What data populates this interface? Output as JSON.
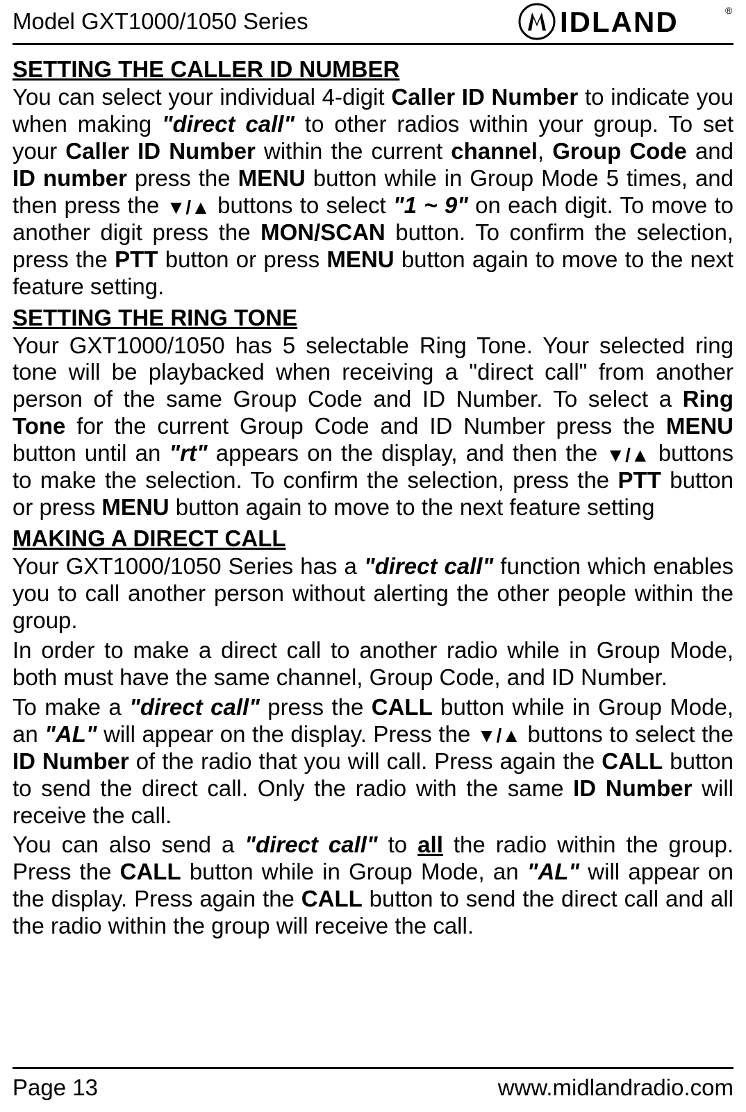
{
  "header": {
    "model": "Model GXT1000/1050 Series",
    "brand": "MIDLAND",
    "reg": "®"
  },
  "sections": {
    "s1": {
      "title": "SETTING THE CALLER ID NUMBER",
      "p1_a": "You can select your individual 4-digit ",
      "p1_b": "Caller ID Number",
      "p1_c": " to indicate you when making ",
      "p1_d": "\"direct call\"",
      "p1_e": " to other radios within your group. To set your ",
      "p1_f": "Caller ID Number",
      "p1_g": " within the current ",
      "p1_h": "channel",
      "p1_i": ", ",
      "p1_j": "Group Code",
      "p1_k": " and ",
      "p1_l": "ID number",
      "p1_m": " press the ",
      "p1_n": "MENU",
      "p1_o": " button while in Group Mode 5 times, and then press the ",
      "p1_p": " buttons to select ",
      "p1_q": "\"1 ~ 9\"",
      "p1_r": " on each digit. To move to another digit press the ",
      "p1_s": "MON/SCAN",
      "p1_t": " button. To confirm the selection, press the ",
      "p1_u": "PTT",
      "p1_v": " button or press ",
      "p1_w": "MENU",
      "p1_x": " button again to move to the next feature setting."
    },
    "s2": {
      "title": "SETTING THE RING TONE",
      "p1_a": "Your GXT1000/1050 has 5 selectable Ring Tone. Your selected ring tone will be playbacked when receiving a \"direct call\" from another person of the same Group Code and ID Number.  To select a ",
      "p1_b": "Ring Tone",
      "p1_c": " for the current Group Code and ID Number press the ",
      "p1_d": "MENU",
      "p1_e": " button until an ",
      "p1_f": "\"rt\"",
      "p1_g": " appears on the display, and then the ",
      "p1_h": " buttons to make the selection. To confirm the selection, press the ",
      "p1_i": "PTT",
      "p1_j": " button or press ",
      "p1_k": "MENU",
      "p1_l": " button again to move to the next feature setting"
    },
    "s3": {
      "title": "MAKING A DIRECT CALL",
      "p1_a": "Your GXT1000/1050 Series has a ",
      "p1_b": "\"direct call\"",
      "p1_c": " function which enables you to call another person without alerting the other people within the group.",
      "p2": "In order to make a direct call to another radio while in Group Mode, both must have the same channel, Group Code, and ID Number.",
      "p3_a": "To make a ",
      "p3_b": "\"direct call\"",
      "p3_c": " press the ",
      "p3_d": "CALL",
      "p3_e": " button while in Group Mode, an ",
      "p3_f": "\"AL\"",
      "p3_g": " will appear on the display. Press the ",
      "p3_h": " buttons to select the ",
      "p3_i": "ID Number",
      "p3_j": " of the radio that you will call. Press again the ",
      "p3_k": "CALL",
      "p3_l": " button to send the direct call. Only the radio with the same ",
      "p3_m": "ID Number",
      "p3_n": " will receive the call.",
      "p4_a": "You can also send a ",
      "p4_b": "\"direct call\"",
      "p4_c": " to ",
      "p4_d": "all",
      "p4_e": " the radio within the group. Press the ",
      "p4_f": "CALL",
      "p4_g": " button while in Group Mode, an ",
      "p4_h": "\"AL\"",
      "p4_i": " will appear on the display. Press again the ",
      "p4_j": "CALL",
      "p4_k": " button to send the direct call and all the radio within the group will receive the call."
    }
  },
  "footer": {
    "page": "Page 13",
    "url": "www.midlandradio.com"
  },
  "icons": {
    "arrows": "▼/▲"
  }
}
